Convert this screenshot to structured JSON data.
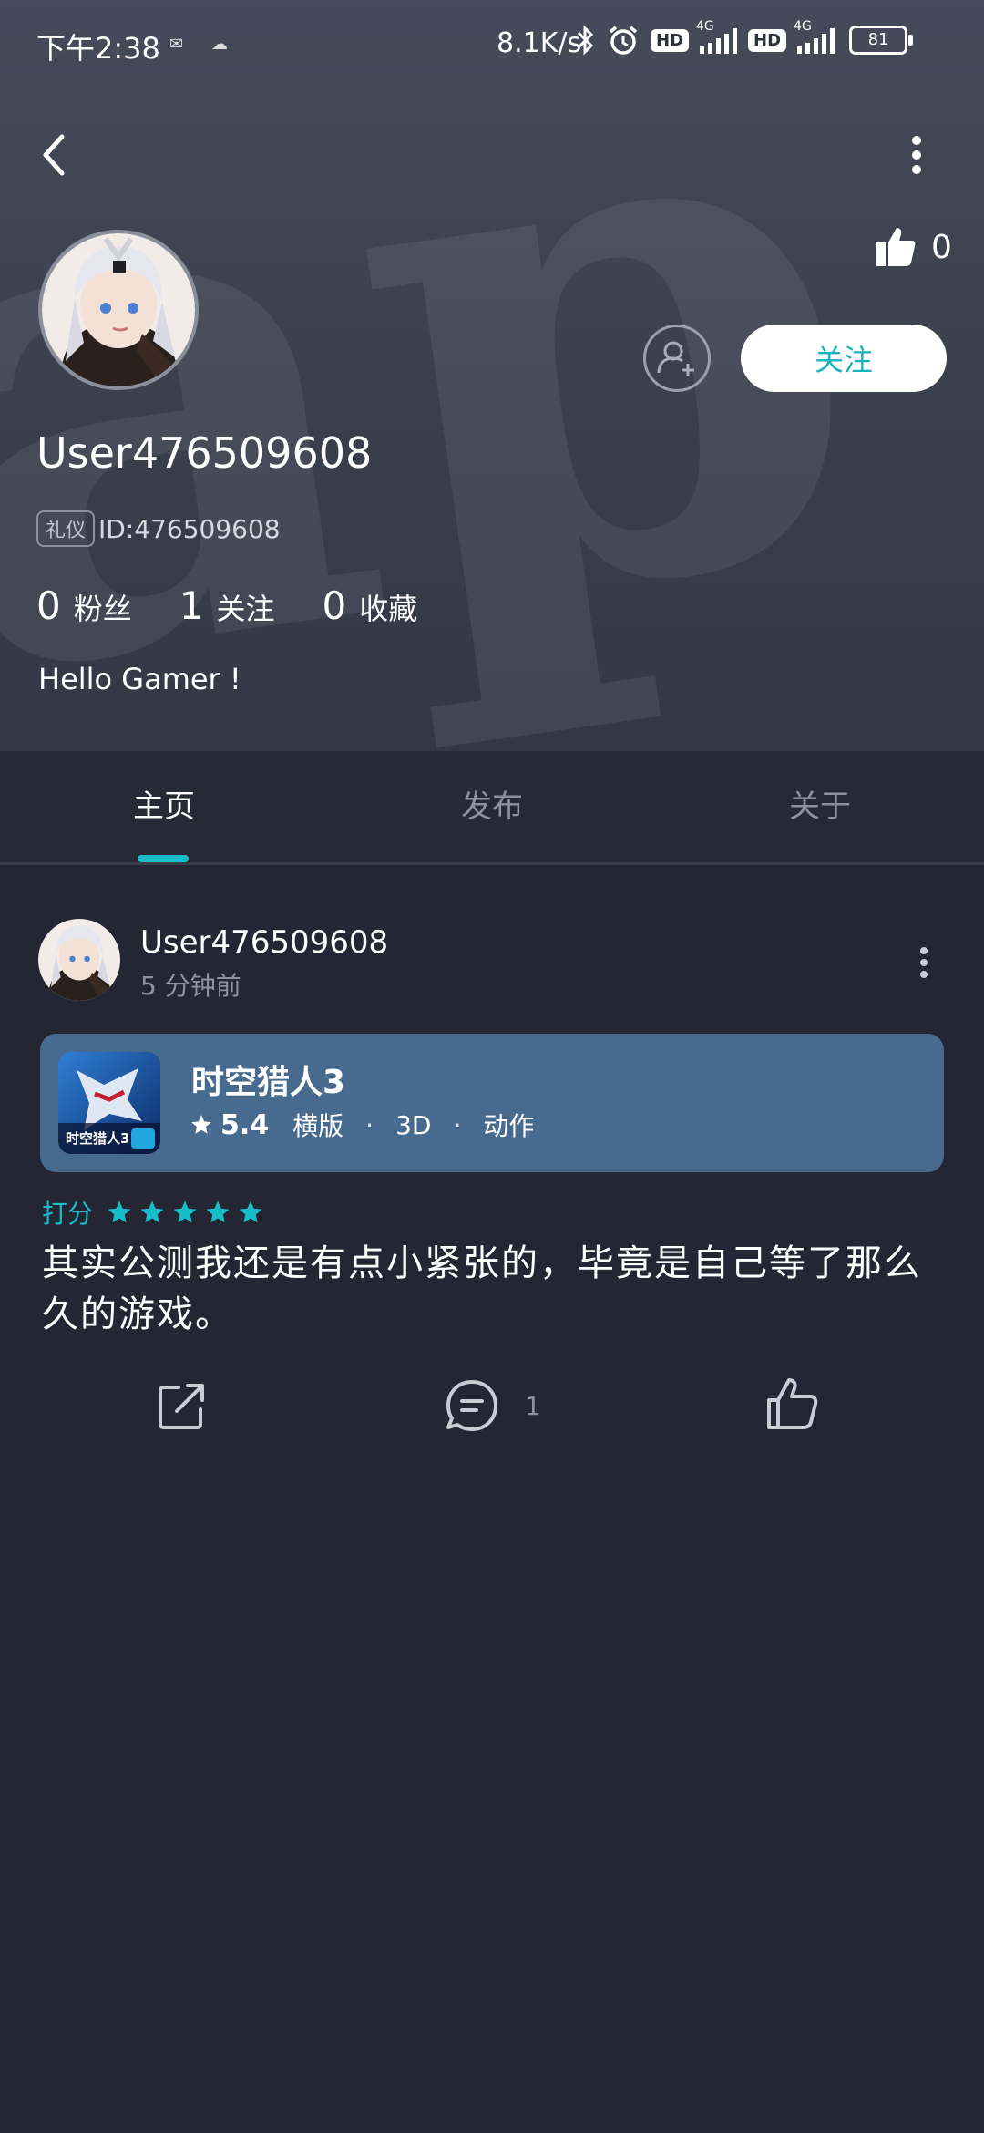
{
  "status_bar": {
    "time": "下午2:38",
    "net_speed": "8.1K/s",
    "hd1": "HD",
    "hd2": "HD",
    "sig1": "4G",
    "sig2": "4G",
    "battery": "81"
  },
  "profile": {
    "like_count": "0",
    "follow_label": "关注",
    "username": "User476509608",
    "id_tag": "礼仪",
    "id_text": "ID:476509608",
    "stats": [
      {
        "num": "0",
        "label": "粉丝"
      },
      {
        "num": "1",
        "label": "关注"
      },
      {
        "num": "0",
        "label": "收藏"
      }
    ],
    "bio": "Hello Gamer !"
  },
  "tabs": [
    {
      "label": "主页",
      "active": true
    },
    {
      "label": "发布",
      "active": false
    },
    {
      "label": "关于",
      "active": false
    }
  ],
  "post": {
    "author": "User476509608",
    "time": "5 分钟前",
    "game": {
      "name": "时空猎人3",
      "score": "5.4",
      "tags": [
        "横版",
        "3D",
        "动作"
      ]
    },
    "rating_label": "打分",
    "rating_stars": 5,
    "body": "其实公测我还是有点小紧张的，毕竟是自己等了那么久的游戏。",
    "comment_count": "1"
  },
  "colors": {
    "accent": "#17bcc8",
    "background": "#242733",
    "card": "#476a8f"
  }
}
